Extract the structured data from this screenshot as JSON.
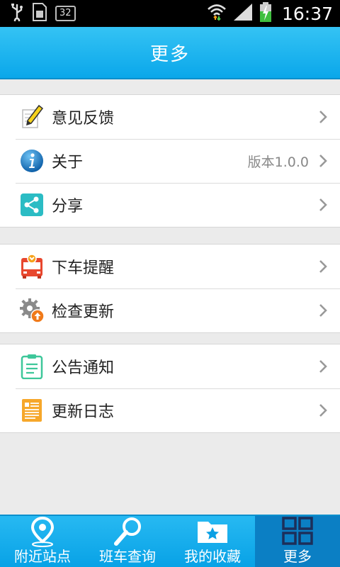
{
  "status_bar": {
    "time": "16:37",
    "notification_badge": "32",
    "icons": [
      "usb-icon",
      "sim-card-icon",
      "wifi-icon",
      "signal-icon",
      "battery-charging-icon"
    ]
  },
  "header": {
    "title": "更多"
  },
  "menu_groups": [
    {
      "items": [
        {
          "label": "意见反馈",
          "icon": "feedback-pencil-icon",
          "value": ""
        },
        {
          "label": "关于",
          "icon": "info-icon",
          "value": "版本1.0.0"
        },
        {
          "label": "分享",
          "icon": "share-icon",
          "value": ""
        }
      ]
    },
    {
      "items": [
        {
          "label": "下车提醒",
          "icon": "bus-alarm-icon",
          "value": ""
        },
        {
          "label": "检查更新",
          "icon": "gear-update-icon",
          "value": ""
        }
      ]
    },
    {
      "items": [
        {
          "label": "公告通知",
          "icon": "clipboard-icon",
          "value": ""
        },
        {
          "label": "更新日志",
          "icon": "log-document-icon",
          "value": ""
        }
      ]
    }
  ],
  "bottom_nav": {
    "items": [
      {
        "label": "附近站点",
        "icon": "location-pin-icon",
        "active": false
      },
      {
        "label": "班车查询",
        "icon": "search-icon",
        "active": false
      },
      {
        "label": "我的收藏",
        "icon": "favorites-folder-icon",
        "active": false
      },
      {
        "label": "更多",
        "icon": "grid-more-icon",
        "active": true
      }
    ]
  },
  "colors": {
    "header_blue": "#0aa7ea",
    "nav_active": "#0b7fc4",
    "page_background": "#ebebeb"
  }
}
